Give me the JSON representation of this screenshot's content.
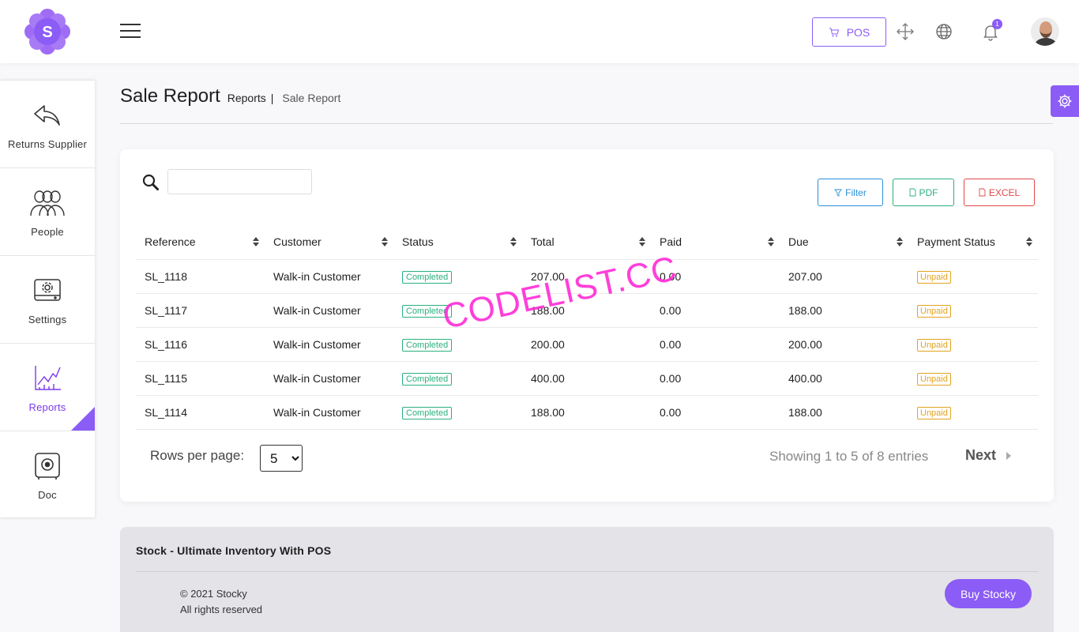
{
  "header": {
    "pos_label": "POS",
    "notification_count": "1"
  },
  "sidebar": {
    "items": [
      {
        "label": "Returns Supplier"
      },
      {
        "label": "People"
      },
      {
        "label": "Settings"
      },
      {
        "label": "Reports",
        "active": true
      },
      {
        "label": "Doc"
      }
    ]
  },
  "page": {
    "title": "Sale Report",
    "breadcrumb_parent": "Reports",
    "breadcrumb_separator": "|",
    "breadcrumb_current": "Sale Report"
  },
  "toolbar": {
    "search_value": "",
    "filter_label": "Filter",
    "pdf_label": "PDF",
    "excel_label": "EXCEL"
  },
  "table": {
    "columns": [
      "Reference",
      "Customer",
      "Status",
      "Total",
      "Paid",
      "Due",
      "Payment Status"
    ],
    "rows": [
      {
        "reference": "SL_1118",
        "customer": "Walk-in Customer",
        "status": "Completed",
        "total": "207.00",
        "paid": "0.00",
        "due": "207.00",
        "payment_status": "Unpaid"
      },
      {
        "reference": "SL_1117",
        "customer": "Walk-in Customer",
        "status": "Completed",
        "total": "188.00",
        "paid": "0.00",
        "due": "188.00",
        "payment_status": "Unpaid"
      },
      {
        "reference": "SL_1116",
        "customer": "Walk-in Customer",
        "status": "Completed",
        "total": "200.00",
        "paid": "0.00",
        "due": "200.00",
        "payment_status": "Unpaid"
      },
      {
        "reference": "SL_1115",
        "customer": "Walk-in Customer",
        "status": "Completed",
        "total": "400.00",
        "paid": "0.00",
        "due": "400.00",
        "payment_status": "Unpaid"
      },
      {
        "reference": "SL_1114",
        "customer": "Walk-in Customer",
        "status": "Completed",
        "total": "188.00",
        "paid": "0.00",
        "due": "188.00",
        "payment_status": "Unpaid"
      }
    ]
  },
  "pagination": {
    "rows_per_page_label": "Rows per page:",
    "rows_per_page_value": "5",
    "showing_text": "Showing 1 to 5 of 8 entries",
    "next_label": "Next"
  },
  "watermark": "CODELIST.CC",
  "footer": {
    "title": "Stock - Ultimate Inventory With POS",
    "copyright": "© 2021 Stocky",
    "rights": "All rights reserved",
    "buy_label": "Buy Stocky"
  },
  "colors": {
    "accent": "#8b5cf6",
    "completed": "#2bb07f",
    "unpaid": "#e2a321",
    "filter": "#2b8fd6",
    "excel": "#e04848",
    "watermark": "#ff2bd6"
  }
}
